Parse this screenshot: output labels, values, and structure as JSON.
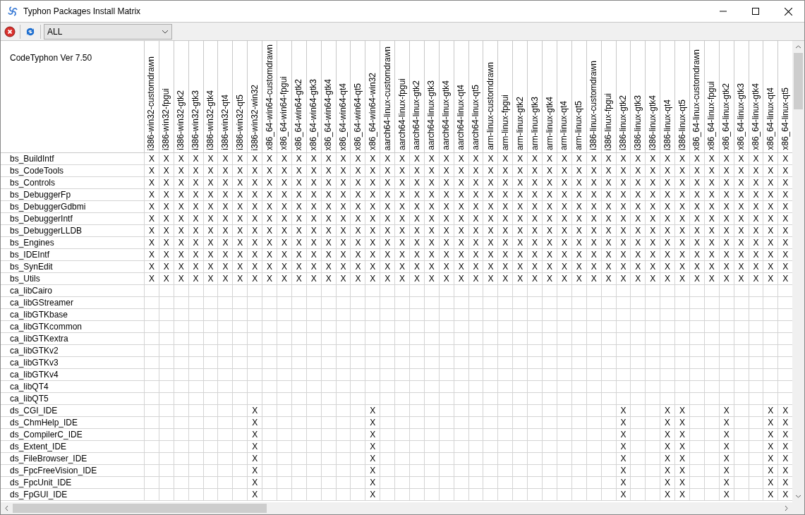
{
  "window": {
    "title": "Typhon Packages Install Matrix"
  },
  "toolbar": {
    "filter": {
      "value": "ALL"
    }
  },
  "matrix": {
    "corner": "CodeTyphon Ver 7.50",
    "columns": [
      "i386-win32-customdrawn",
      "i386-win32-fpgui",
      "i386-win32-gtk2",
      "i386-win32-gtk3",
      "i386-win32-gtk4",
      "i386-win32-qt4",
      "i386-win32-qt5",
      "i386-win32-win32",
      "x86_64-win64-customdrawn",
      "x86_64-win64-fpgui",
      "x86_64-win64-gtk2",
      "x86_64-win64-gtk3",
      "x86_64-win64-gtk4",
      "x86_64-win64-qt4",
      "x86_64-win64-qt5",
      "x86_64-win64-win32",
      "aarch64-linux-customdrawn",
      "aarch64-linux-fpgui",
      "aarch64-linux-gtk2",
      "aarch64-linux-gtk3",
      "aarch64-linux-gtk4",
      "aarch64-linux-qt4",
      "aarch64-linux-qt5",
      "arm-linux-customdrawn",
      "arm-linux-fpgui",
      "arm-linux-gtk2",
      "arm-linux-gtk3",
      "arm-linux-gtk4",
      "arm-linux-qt4",
      "arm-linux-qt5",
      "i386-linux-customdrawn",
      "i386-linux-fpgui",
      "i386-linux-gtk2",
      "i386-linux-gtk3",
      "i386-linux-gtk4",
      "i386-linux-qt4",
      "i386-linux-qt5",
      "x86_64-linux-customdrawn",
      "x86_64-linux-fpgui",
      "x86_64-linux-gtk2",
      "x86_64-linux-gtk3",
      "x86_64-linux-gtk4",
      "x86_64-linux-qt4",
      "x86_64-linux-qt5"
    ],
    "rows": [
      {
        "name": "bs_BuildIntf",
        "cells": [
          "X",
          "X",
          "X",
          "X",
          "X",
          "X",
          "X",
          "X",
          "X",
          "X",
          "X",
          "X",
          "X",
          "X",
          "X",
          "X",
          "X",
          "X",
          "X",
          "X",
          "X",
          "X",
          "X",
          "X",
          "X",
          "X",
          "X",
          "X",
          "X",
          "X",
          "X",
          "X",
          "X",
          "X",
          "X",
          "X",
          "X",
          "X",
          "X",
          "X",
          "X",
          "X",
          "X",
          "X"
        ]
      },
      {
        "name": "bs_CodeTools",
        "cells": [
          "X",
          "X",
          "X",
          "X",
          "X",
          "X",
          "X",
          "X",
          "X",
          "X",
          "X",
          "X",
          "X",
          "X",
          "X",
          "X",
          "X",
          "X",
          "X",
          "X",
          "X",
          "X",
          "X",
          "X",
          "X",
          "X",
          "X",
          "X",
          "X",
          "X",
          "X",
          "X",
          "X",
          "X",
          "X",
          "X",
          "X",
          "X",
          "X",
          "X",
          "X",
          "X",
          "X",
          "X"
        ]
      },
      {
        "name": "bs_Controls",
        "cells": [
          "X",
          "X",
          "X",
          "X",
          "X",
          "X",
          "X",
          "X",
          "X",
          "X",
          "X",
          "X",
          "X",
          "X",
          "X",
          "X",
          "X",
          "X",
          "X",
          "X",
          "X",
          "X",
          "X",
          "X",
          "X",
          "X",
          "X",
          "X",
          "X",
          "X",
          "X",
          "X",
          "X",
          "X",
          "X",
          "X",
          "X",
          "X",
          "X",
          "X",
          "X",
          "X",
          "X",
          "X"
        ]
      },
      {
        "name": "bs_DebuggerFp",
        "cells": [
          "X",
          "X",
          "X",
          "X",
          "X",
          "X",
          "X",
          "X",
          "X",
          "X",
          "X",
          "X",
          "X",
          "X",
          "X",
          "X",
          "X",
          "X",
          "X",
          "X",
          "X",
          "X",
          "X",
          "X",
          "X",
          "X",
          "X",
          "X",
          "X",
          "X",
          "X",
          "X",
          "X",
          "X",
          "X",
          "X",
          "X",
          "X",
          "X",
          "X",
          "X",
          "X",
          "X",
          "X"
        ]
      },
      {
        "name": "bs_DebuggerGdbmi",
        "cells": [
          "X",
          "X",
          "X",
          "X",
          "X",
          "X",
          "X",
          "X",
          "X",
          "X",
          "X",
          "X",
          "X",
          "X",
          "X",
          "X",
          "X",
          "X",
          "X",
          "X",
          "X",
          "X",
          "X",
          "X",
          "X",
          "X",
          "X",
          "X",
          "X",
          "X",
          "X",
          "X",
          "X",
          "X",
          "X",
          "X",
          "X",
          "X",
          "X",
          "X",
          "X",
          "X",
          "X",
          "X"
        ]
      },
      {
        "name": "bs_DebuggerIntf",
        "cells": [
          "X",
          "X",
          "X",
          "X",
          "X",
          "X",
          "X",
          "X",
          "X",
          "X",
          "X",
          "X",
          "X",
          "X",
          "X",
          "X",
          "X",
          "X",
          "X",
          "X",
          "X",
          "X",
          "X",
          "X",
          "X",
          "X",
          "X",
          "X",
          "X",
          "X",
          "X",
          "X",
          "X",
          "X",
          "X",
          "X",
          "X",
          "X",
          "X",
          "X",
          "X",
          "X",
          "X",
          "X"
        ]
      },
      {
        "name": "bs_DebuggerLLDB",
        "cells": [
          "X",
          "X",
          "X",
          "X",
          "X",
          "X",
          "X",
          "X",
          "X",
          "X",
          "X",
          "X",
          "X",
          "X",
          "X",
          "X",
          "X",
          "X",
          "X",
          "X",
          "X",
          "X",
          "X",
          "X",
          "X",
          "X",
          "X",
          "X",
          "X",
          "X",
          "X",
          "X",
          "X",
          "X",
          "X",
          "X",
          "X",
          "X",
          "X",
          "X",
          "X",
          "X",
          "X",
          "X"
        ]
      },
      {
        "name": "bs_Engines",
        "cells": [
          "X",
          "X",
          "X",
          "X",
          "X",
          "X",
          "X",
          "X",
          "X",
          "X",
          "X",
          "X",
          "X",
          "X",
          "X",
          "X",
          "X",
          "X",
          "X",
          "X",
          "X",
          "X",
          "X",
          "X",
          "X",
          "X",
          "X",
          "X",
          "X",
          "X",
          "X",
          "X",
          "X",
          "X",
          "X",
          "X",
          "X",
          "X",
          "X",
          "X",
          "X",
          "X",
          "X",
          "X"
        ]
      },
      {
        "name": "bs_IDEIntf",
        "cells": [
          "X",
          "X",
          "X",
          "X",
          "X",
          "X",
          "X",
          "X",
          "X",
          "X",
          "X",
          "X",
          "X",
          "X",
          "X",
          "X",
          "X",
          "X",
          "X",
          "X",
          "X",
          "X",
          "X",
          "X",
          "X",
          "X",
          "X",
          "X",
          "X",
          "X",
          "X",
          "X",
          "X",
          "X",
          "X",
          "X",
          "X",
          "X",
          "X",
          "X",
          "X",
          "X",
          "X",
          "X"
        ]
      },
      {
        "name": "bs_SynEdit",
        "cells": [
          "X",
          "X",
          "X",
          "X",
          "X",
          "X",
          "X",
          "X",
          "X",
          "X",
          "X",
          "X",
          "X",
          "X",
          "X",
          "X",
          "X",
          "X",
          "X",
          "X",
          "X",
          "X",
          "X",
          "X",
          "X",
          "X",
          "X",
          "X",
          "X",
          "X",
          "X",
          "X",
          "X",
          "X",
          "X",
          "X",
          "X",
          "X",
          "X",
          "X",
          "X",
          "X",
          "X",
          "X"
        ]
      },
      {
        "name": "bs_Utils",
        "cells": [
          "X",
          "X",
          "X",
          "X",
          "X",
          "X",
          "X",
          "X",
          "X",
          "X",
          "X",
          "X",
          "X",
          "X",
          "X",
          "X",
          "X",
          "X",
          "X",
          "X",
          "X",
          "X",
          "X",
          "X",
          "X",
          "X",
          "X",
          "X",
          "X",
          "X",
          "X",
          "X",
          "X",
          "X",
          "X",
          "X",
          "X",
          "X",
          "X",
          "X",
          "X",
          "X",
          "X",
          "X"
        ]
      },
      {
        "name": "ca_libCairo",
        "cells": [
          null,
          null,
          null,
          null,
          null,
          null,
          null,
          null,
          null,
          null,
          null,
          null,
          null,
          null,
          null,
          null,
          null,
          null,
          null,
          null,
          null,
          null,
          null,
          null,
          null,
          null,
          null,
          null,
          null,
          null,
          null,
          null,
          null,
          null,
          null,
          null,
          null,
          null,
          null,
          null,
          null,
          null,
          null,
          null
        ]
      },
      {
        "name": "ca_libGStreamer",
        "cells": [
          null,
          null,
          null,
          null,
          null,
          null,
          null,
          null,
          null,
          null,
          null,
          null,
          null,
          null,
          null,
          null,
          null,
          null,
          null,
          null,
          null,
          null,
          null,
          null,
          null,
          null,
          null,
          null,
          null,
          null,
          null,
          null,
          null,
          null,
          null,
          null,
          null,
          null,
          null,
          null,
          null,
          null,
          null,
          null
        ]
      },
      {
        "name": "ca_libGTKbase",
        "cells": [
          null,
          null,
          null,
          null,
          null,
          null,
          null,
          null,
          null,
          null,
          null,
          null,
          null,
          null,
          null,
          null,
          null,
          null,
          null,
          null,
          null,
          null,
          null,
          null,
          null,
          null,
          null,
          null,
          null,
          null,
          null,
          null,
          null,
          null,
          null,
          null,
          null,
          null,
          null,
          null,
          null,
          null,
          null,
          null
        ]
      },
      {
        "name": "ca_libGTKcommon",
        "cells": [
          null,
          null,
          null,
          null,
          null,
          null,
          null,
          null,
          null,
          null,
          null,
          null,
          null,
          null,
          null,
          null,
          null,
          null,
          null,
          null,
          null,
          null,
          null,
          null,
          null,
          null,
          null,
          null,
          null,
          null,
          null,
          null,
          null,
          null,
          null,
          null,
          null,
          null,
          null,
          null,
          null,
          null,
          null,
          null
        ]
      },
      {
        "name": "ca_libGTKextra",
        "cells": [
          null,
          null,
          null,
          null,
          null,
          null,
          null,
          null,
          null,
          null,
          null,
          null,
          null,
          null,
          null,
          null,
          null,
          null,
          null,
          null,
          null,
          null,
          null,
          null,
          null,
          null,
          null,
          null,
          null,
          null,
          null,
          null,
          null,
          null,
          null,
          null,
          null,
          null,
          null,
          null,
          null,
          null,
          null,
          null
        ]
      },
      {
        "name": "ca_libGTKv2",
        "cells": [
          null,
          null,
          null,
          null,
          null,
          null,
          null,
          null,
          null,
          null,
          null,
          null,
          null,
          null,
          null,
          null,
          null,
          null,
          null,
          null,
          null,
          null,
          null,
          null,
          null,
          null,
          null,
          null,
          null,
          null,
          null,
          null,
          null,
          null,
          null,
          null,
          null,
          null,
          null,
          null,
          null,
          null,
          null,
          null
        ]
      },
      {
        "name": "ca_libGTKv3",
        "cells": [
          null,
          null,
          null,
          null,
          null,
          null,
          null,
          null,
          null,
          null,
          null,
          null,
          null,
          null,
          null,
          null,
          null,
          null,
          null,
          null,
          null,
          null,
          null,
          null,
          null,
          null,
          null,
          null,
          null,
          null,
          null,
          null,
          null,
          null,
          null,
          null,
          null,
          null,
          null,
          null,
          null,
          null,
          null,
          null
        ]
      },
      {
        "name": "ca_libGTKv4",
        "cells": [
          null,
          null,
          null,
          null,
          null,
          null,
          null,
          null,
          null,
          null,
          null,
          null,
          null,
          null,
          null,
          null,
          null,
          null,
          null,
          null,
          null,
          null,
          null,
          null,
          null,
          null,
          null,
          null,
          null,
          null,
          null,
          null,
          null,
          null,
          null,
          null,
          null,
          null,
          null,
          null,
          null,
          null,
          null,
          null
        ]
      },
      {
        "name": "ca_libQT4",
        "cells": [
          null,
          null,
          null,
          null,
          null,
          null,
          null,
          null,
          null,
          null,
          null,
          null,
          null,
          null,
          null,
          null,
          null,
          null,
          null,
          null,
          null,
          null,
          null,
          null,
          null,
          null,
          null,
          null,
          null,
          null,
          null,
          null,
          null,
          null,
          null,
          null,
          null,
          null,
          null,
          null,
          null,
          null,
          null,
          null
        ]
      },
      {
        "name": "ca_libQT5",
        "cells": [
          null,
          null,
          null,
          null,
          null,
          null,
          null,
          null,
          null,
          null,
          null,
          null,
          null,
          null,
          null,
          null,
          null,
          null,
          null,
          null,
          null,
          null,
          null,
          null,
          null,
          null,
          null,
          null,
          null,
          null,
          null,
          null,
          null,
          null,
          null,
          null,
          null,
          null,
          null,
          null,
          null,
          null,
          null,
          null
        ]
      },
      {
        "name": "ds_CGI_IDE",
        "cells": [
          null,
          null,
          null,
          null,
          null,
          null,
          null,
          "X",
          null,
          null,
          null,
          null,
          null,
          null,
          null,
          "X",
          null,
          null,
          null,
          null,
          null,
          null,
          null,
          null,
          null,
          null,
          null,
          null,
          null,
          null,
          null,
          null,
          "X",
          null,
          null,
          "X",
          "X",
          null,
          null,
          "X",
          null,
          null,
          "X",
          "X"
        ]
      },
      {
        "name": "ds_ChmHelp_IDE",
        "cells": [
          null,
          null,
          null,
          null,
          null,
          null,
          null,
          "X",
          null,
          null,
          null,
          null,
          null,
          null,
          null,
          "X",
          null,
          null,
          null,
          null,
          null,
          null,
          null,
          null,
          null,
          null,
          null,
          null,
          null,
          null,
          null,
          null,
          "X",
          null,
          null,
          "X",
          "X",
          null,
          null,
          "X",
          null,
          null,
          "X",
          "X"
        ]
      },
      {
        "name": "ds_CompilerC_IDE",
        "cells": [
          null,
          null,
          null,
          null,
          null,
          null,
          null,
          "X",
          null,
          null,
          null,
          null,
          null,
          null,
          null,
          "X",
          null,
          null,
          null,
          null,
          null,
          null,
          null,
          null,
          null,
          null,
          null,
          null,
          null,
          null,
          null,
          null,
          "X",
          null,
          null,
          "X",
          "X",
          null,
          null,
          "X",
          null,
          null,
          "X",
          "X"
        ]
      },
      {
        "name": "ds_Extent_IDE",
        "cells": [
          null,
          null,
          null,
          null,
          null,
          null,
          null,
          "X",
          null,
          null,
          null,
          null,
          null,
          null,
          null,
          "X",
          null,
          null,
          null,
          null,
          null,
          null,
          null,
          null,
          null,
          null,
          null,
          null,
          null,
          null,
          null,
          null,
          "X",
          null,
          null,
          "X",
          "X",
          null,
          null,
          "X",
          null,
          null,
          "X",
          "X"
        ]
      },
      {
        "name": "ds_FileBrowser_IDE",
        "cells": [
          null,
          null,
          null,
          null,
          null,
          null,
          null,
          "X",
          null,
          null,
          null,
          null,
          null,
          null,
          null,
          "X",
          null,
          null,
          null,
          null,
          null,
          null,
          null,
          null,
          null,
          null,
          null,
          null,
          null,
          null,
          null,
          null,
          "X",
          null,
          null,
          "X",
          "X",
          null,
          null,
          "X",
          null,
          null,
          "X",
          "X"
        ]
      },
      {
        "name": "ds_FpcFreeVision_IDE",
        "cells": [
          null,
          null,
          null,
          null,
          null,
          null,
          null,
          "X",
          null,
          null,
          null,
          null,
          null,
          null,
          null,
          "X",
          null,
          null,
          null,
          null,
          null,
          null,
          null,
          null,
          null,
          null,
          null,
          null,
          null,
          null,
          null,
          null,
          "X",
          null,
          null,
          "X",
          "X",
          null,
          null,
          "X",
          null,
          null,
          "X",
          "X"
        ]
      },
      {
        "name": "ds_FpcUnit_IDE",
        "cells": [
          null,
          null,
          null,
          null,
          null,
          null,
          null,
          "X",
          null,
          null,
          null,
          null,
          null,
          null,
          null,
          "X",
          null,
          null,
          null,
          null,
          null,
          null,
          null,
          null,
          null,
          null,
          null,
          null,
          null,
          null,
          null,
          null,
          "X",
          null,
          null,
          "X",
          "X",
          null,
          null,
          "X",
          null,
          null,
          "X",
          "X"
        ]
      },
      {
        "name": "ds_FpGUI_IDE",
        "cells": [
          null,
          null,
          null,
          null,
          null,
          null,
          null,
          "X",
          null,
          null,
          null,
          null,
          null,
          null,
          null,
          "X",
          null,
          null,
          null,
          null,
          null,
          null,
          null,
          null,
          null,
          null,
          null,
          null,
          null,
          null,
          null,
          null,
          "X",
          null,
          null,
          "X",
          "X",
          null,
          null,
          "X",
          null,
          null,
          "X",
          "X"
        ]
      }
    ]
  }
}
